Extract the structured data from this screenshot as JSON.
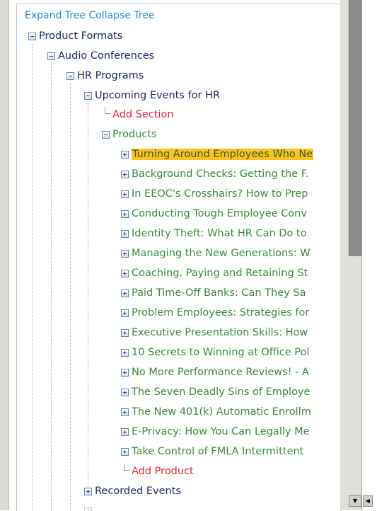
{
  "toolbar": {
    "expand_label": "Expand Tree",
    "collapse_label": "Collapse Tree"
  },
  "tree": {
    "root": "Product Formats",
    "audio": "Audio Conferences",
    "hr": "HR Programs",
    "upcoming": "Upcoming Events for HR",
    "add_section": "Add Section",
    "products": "Products",
    "items": [
      "Turning Around Employees Who Ne",
      "Background Checks: Getting the F.",
      "In EEOC's Crosshairs? How to Prep",
      "Conducting Tough Employee Conv",
      "Identity Theft: What HR Can Do to",
      "Managing the New Generations: W",
      "Coaching, Paying and Retaining St",
      "Paid Time-Off Banks: Can They Sa",
      "Problem Employees: Strategies for",
      "Executive Presentation Skills: How",
      "10 Secrets to Winning at Office Pol",
      "No More Performance Reviews! - A",
      "The Seven Deadly Sins of Employe",
      "The New 401(k) Automatic Enrollm",
      "E-Privacy: How You Can Legally Me",
      "Take Control of FMLA Intermittent"
    ],
    "add_product": "Add Product",
    "recorded": "Recorded Events"
  },
  "colors": {
    "link_blue": "#2a8ad1",
    "navy": "#1e2a6a",
    "green": "#3b8a3b",
    "red": "#e8282e",
    "highlight": "#ffc21a"
  }
}
